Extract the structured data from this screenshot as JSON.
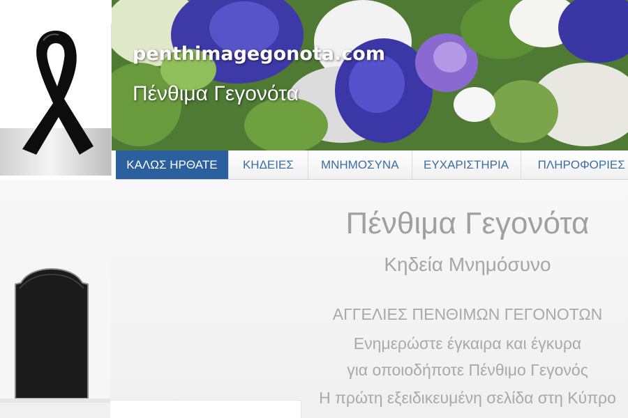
{
  "header": {
    "logo_text": "penthimagegonota",
    "site_url": "penthimagegonota.com",
    "site_name": "Πένθιμα Γεγονότα"
  },
  "nav": {
    "items": [
      {
        "label": "ΚΑΛΩΣ ΗΡΘΑΤΕ",
        "active": true
      },
      {
        "label": "ΚΗΔΕΙΕΣ",
        "active": false
      },
      {
        "label": "ΜΝΗΜΟΣΥΝΑ",
        "active": false
      },
      {
        "label": "ΕΥΧΑΡΙΣΤΗΡΙΑ",
        "active": false
      },
      {
        "label": "ΠΛΗΡΟΦΟΡΙΕΣ",
        "active": false
      }
    ]
  },
  "main": {
    "title": "Πένθιμα Γεγονότα",
    "subtitle": "Κηδεία Μνημόσυνο",
    "lines": [
      "ΑΓΓΕΛΙΕΣ ΠΕΝΘΙΜΩΝ ΓΕΓΟΝΟΤΩΝ",
      "Ενημερώστε έγκαιρα και έγκυρα",
      "για οποιοδήποτε Πένθιμο Γεγονός",
      "Η πρώτη εξειδικευμένη σελίδα στη Κύπρο"
    ]
  },
  "colors": {
    "nav_active_bg": "#2c5f9e",
    "nav_text": "#3a6ea5",
    "body_text": "#a6a6a6"
  },
  "icons": {
    "logo": "black-ribbon-icon",
    "tombstone": "tombstone-image"
  }
}
